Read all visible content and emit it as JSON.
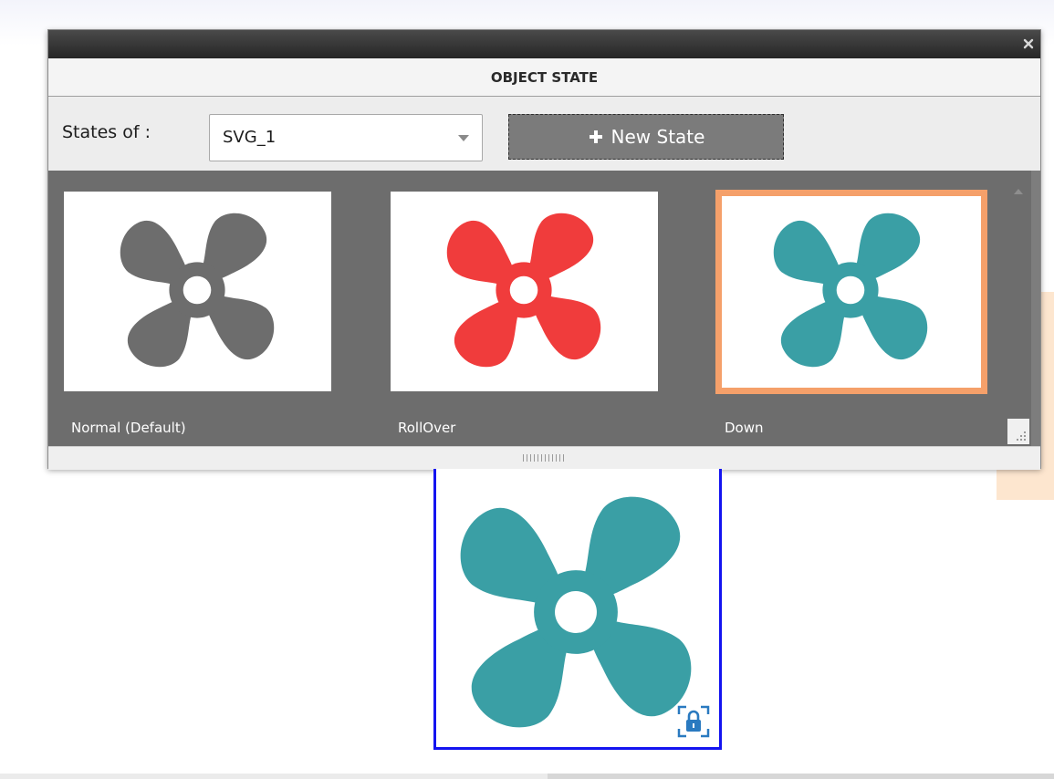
{
  "panel": {
    "title": "OBJECT STATE",
    "states_of_label": "States of :",
    "states_select": {
      "value": "SVG_1"
    },
    "new_state_button": "New State"
  },
  "states": [
    {
      "label": "Normal (Default)",
      "color": "#6d6d6d",
      "selected": false
    },
    {
      "label": "RollOver",
      "color": "#f03c3c",
      "selected": false
    },
    {
      "label": "Down",
      "color": "#3a9fa5",
      "selected": true
    }
  ],
  "canvas": {
    "object_color": "#3a9fa5",
    "lock_icon": "lock-icon"
  },
  "colors": {
    "selection_border": "#f5a06a",
    "canvas_selection": "#1414f0"
  }
}
